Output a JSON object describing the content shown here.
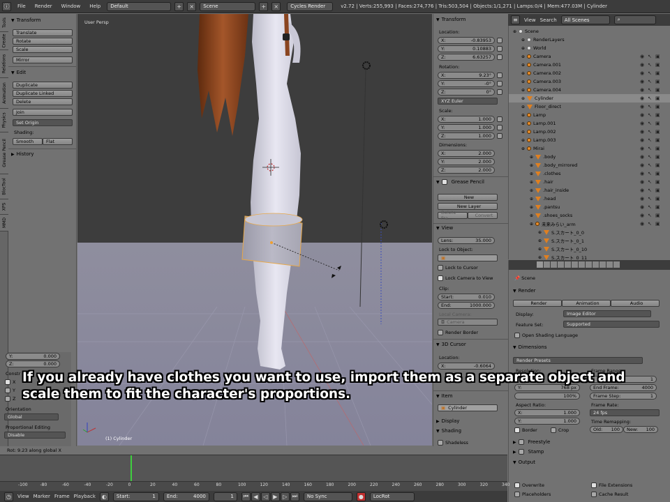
{
  "topbar": {
    "menus": [
      "File",
      "Render",
      "Window",
      "Help"
    ],
    "layout": "Default",
    "scene": "Scene",
    "engine": "Cycles Render",
    "stats": "v2.72 | Verts:255,993 | Faces:274,776 | Tris:503,504 | Objects:1/1,271 | Lamps:0/4 | Mem:477.03M | Cylinder"
  },
  "left_tabs": [
    "Tools",
    "Create",
    "Relations",
    "Animation",
    "Physics",
    "Grease Pencil",
    "BlocTool",
    "XPS",
    "MMD"
  ],
  "tool_shelf": {
    "transform_header": "Transform",
    "transform_buttons": [
      "Translate",
      "Rotate",
      "Scale",
      "Mirror"
    ],
    "edit_header": "Edit",
    "edit_buttons": [
      "Duplicate",
      "Duplicate Linked",
      "Delete",
      "Join",
      "Set Origin"
    ],
    "shading_label": "Shading:",
    "shading_buttons": [
      "Smooth",
      "Flat"
    ],
    "history_header": "History",
    "y_label": "Y:",
    "y_value": "0.000",
    "z_label": "Z:",
    "z_value": "0.000",
    "constraint_label": "Constr",
    "cx": "X",
    "cy": "Y",
    "cz": "Z",
    "orientation_label": "Orientation",
    "orientation_value": "Global",
    "proportional_label": "Proportional Editing",
    "proportional_value": "Disable"
  },
  "viewport": {
    "label": "User Persp",
    "object_label": "(1) Cylinder"
  },
  "npanel": {
    "transform_header": "Transform",
    "location_label": "Location:",
    "loc": [
      [
        "X:",
        "-0.83953"
      ],
      [
        "Y:",
        "0.10883"
      ],
      [
        "Z:",
        "6.63257"
      ]
    ],
    "rotation_label": "Rotation:",
    "rot": [
      [
        "X:",
        "9.23°"
      ],
      [
        "Y:",
        "-0°"
      ],
      [
        "Z:",
        "0°"
      ]
    ],
    "euler": "XYZ Euler",
    "scale_label": "Scale:",
    "scale": [
      [
        "X:",
        "1.000"
      ],
      [
        "Y:",
        "1.000"
      ],
      [
        "Z:",
        "1.000"
      ]
    ],
    "dims_label": "Dimensions:",
    "dims": [
      [
        "X:",
        "2.000"
      ],
      [
        "Y:",
        "2.000"
      ],
      [
        "Z:",
        "2.000"
      ]
    ],
    "gp_header": "Grease Pencil",
    "gp_new": "New",
    "gp_new_layer": "New Layer",
    "gp_delete": "Delete Fra...",
    "gp_convert": "Convert",
    "view_header": "View",
    "lens_label": "Lens:",
    "lens_value": "35.000",
    "lock_obj": "Lock to Object:",
    "lock_cursor": "Lock to Cursor",
    "lock_cam": "Lock Camera to View",
    "clip_label": "Clip:",
    "clip_start_label": "Start:",
    "clip_start": "0.010",
    "clip_end_label": "End:",
    "clip_end": "1000.000",
    "local_camera": "Local Camera:",
    "camera": "Camera",
    "render_border": "Render Border",
    "cursor_header": "3D Cursor",
    "cursor_location": "Location:",
    "cursor_x_label": "X:",
    "cursor_x": "-0.6064",
    "item_header": "Item",
    "item_name": "Cylinder",
    "display_header": "Display",
    "shading_header": "Shading",
    "shadeless": "Shadeless"
  },
  "outliner": {
    "view": "View",
    "search": "Search",
    "filter": "All Scenes",
    "items": [
      {
        "name": "Scene",
        "indent": 0,
        "kind": "scene"
      },
      {
        "name": "RenderLayers",
        "indent": 1,
        "kind": "layer"
      },
      {
        "name": "World",
        "indent": 1,
        "kind": "world"
      },
      {
        "name": "Camera",
        "indent": 1,
        "kind": "cam"
      },
      {
        "name": "Camera.001",
        "indent": 1,
        "kind": "cam"
      },
      {
        "name": "Camera.002",
        "indent": 1,
        "kind": "cam"
      },
      {
        "name": "Camera.003",
        "indent": 1,
        "kind": "cam"
      },
      {
        "name": "Camera.004",
        "indent": 1,
        "kind": "cam"
      },
      {
        "name": "Cylinder",
        "indent": 1,
        "kind": "mesh"
      },
      {
        "name": "Floor_direct",
        "indent": 1,
        "kind": "mesh"
      },
      {
        "name": "Lamp",
        "indent": 1,
        "kind": "lamp"
      },
      {
        "name": "Lamp.001",
        "indent": 1,
        "kind": "lamp"
      },
      {
        "name": "Lamp.002",
        "indent": 1,
        "kind": "lamp"
      },
      {
        "name": "Lamp.003",
        "indent": 1,
        "kind": "lamp"
      },
      {
        "name": "Mirai",
        "indent": 1,
        "kind": "arm"
      },
      {
        "name": ".body",
        "indent": 2,
        "kind": "mesh"
      },
      {
        "name": ".body_mirrored",
        "indent": 2,
        "kind": "mesh"
      },
      {
        "name": ".clothes",
        "indent": 2,
        "kind": "mesh"
      },
      {
        "name": ".hair",
        "indent": 2,
        "kind": "mesh"
      },
      {
        "name": ".hair_inside",
        "indent": 2,
        "kind": "mesh"
      },
      {
        "name": ".head",
        "indent": 2,
        "kind": "mesh"
      },
      {
        "name": ".pantsu",
        "indent": 2,
        "kind": "mesh"
      },
      {
        "name": ".shoes_socks",
        "indent": 2,
        "kind": "mesh"
      },
      {
        "name": "未来みらい_arm",
        "indent": 2,
        "kind": "arm"
      },
      {
        "name": "S.スカート_0_0",
        "indent": 3,
        "kind": "bone"
      },
      {
        "name": "S.スカート_0_1",
        "indent": 3,
        "kind": "bone"
      },
      {
        "name": "S.スカート_0_10",
        "indent": 3,
        "kind": "bone"
      },
      {
        "name": "S.スカート_0_11",
        "indent": 3,
        "kind": "bone"
      }
    ]
  },
  "properties": {
    "scene_name": "Scene",
    "render_header": "Render",
    "render_btn": "Render",
    "animation_btn": "Animation",
    "audio_btn": "Audio",
    "display_label": "Display:",
    "display_value": "Image Editor",
    "featureset_label": "Feature Set:",
    "featureset_value": "Supported",
    "osl": "Open Shading Language",
    "dimensions_header": "Dimensions",
    "presets": "Render Presets",
    "resolution": "Resolution:",
    "res_y_label": "Y:",
    "res_y": "768 px",
    "res_pct": "100%",
    "frame_range": "Frame Range:",
    "end_frame_label": "End Frame:",
    "end_frame": "4000",
    "frame_step_label": "Frame Step:",
    "frame_step": "1",
    "start_frame_value": "1",
    "aspect": "Aspect Ratio:",
    "asp_x_label": "X:",
    "asp_x": "1.000",
    "asp_y_label": "Y:",
    "asp_y": "1.000",
    "frame_rate": "Frame Rate:",
    "fps": "24 fps",
    "time_remap": "Time Remapping:",
    "old_label": "Old:",
    "old": "100",
    "new_label": "New:",
    "new": "100",
    "border": "Border",
    "crop": "Crop",
    "freestyle": "Freestyle",
    "stamp": "Stamp",
    "output": "Output",
    "overwrite": "Overwrite",
    "file_ext": "File Extensions",
    "placeholders": "Placeholders",
    "cache": "Cache Result"
  },
  "status": "Rot: 9.23 along global X",
  "timeline": {
    "ticks": [
      "-100",
      "-80",
      "-60",
      "-40",
      "-20",
      "0",
      "20",
      "40",
      "60",
      "80",
      "100",
      "120",
      "140",
      "160",
      "180",
      "200",
      "220",
      "240",
      "260",
      "280",
      "300",
      "320",
      "340"
    ],
    "menus": [
      "View",
      "Marker",
      "Frame",
      "Playback"
    ],
    "start_label": "Start:",
    "start": "1",
    "end_label": "End:",
    "end": "4000",
    "current": "1",
    "sync": "No Sync",
    "keying": "LocRot"
  },
  "subtitle": {
    "line1": "If you already have clothes you want to use, import them as a separate object and",
    "line2": "scale them to fit the character's proportions."
  }
}
